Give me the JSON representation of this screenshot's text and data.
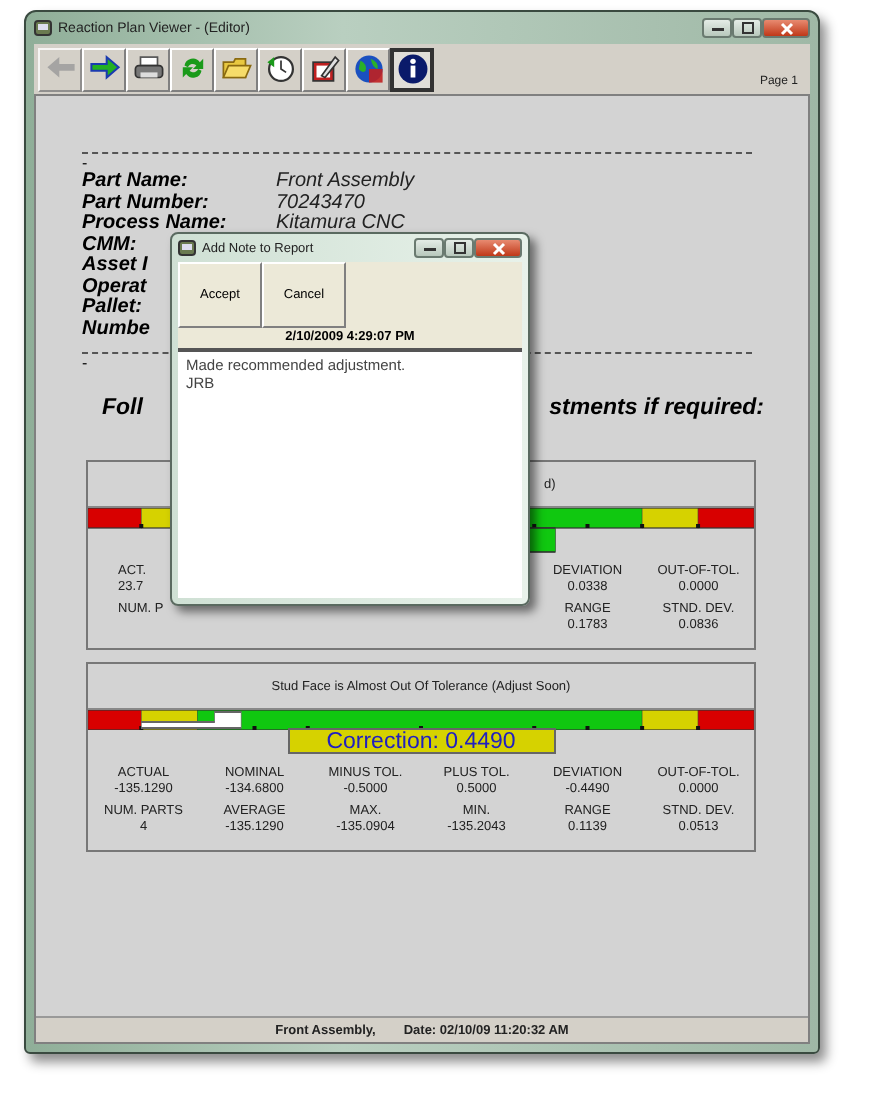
{
  "window": {
    "title": "Reaction Plan Viewer - (Editor)"
  },
  "toolbar": [
    {
      "disabled": true,
      "selected": false
    },
    {
      "disabled": false,
      "selected": false
    },
    {
      "disabled": false,
      "selected": false
    },
    {
      "disabled": false,
      "selected": false
    },
    {
      "disabled": false,
      "selected": false
    },
    {
      "disabled": false,
      "selected": false
    },
    {
      "disabled": false,
      "selected": false
    },
    {
      "disabled": false,
      "selected": false
    },
    {
      "disabled": false,
      "selected": true
    }
  ],
  "page_label": "Page 1",
  "report": {
    "separator_tail_1": "-",
    "fields": [
      {
        "label": "Part Name:",
        "value": "Front Assembly"
      },
      {
        "label": "Part Number:",
        "value": "70243470"
      },
      {
        "label": "Process Name:",
        "value": "Kitamura CNC"
      },
      {
        "label": "CMM:"
      },
      {
        "label": "Asset I"
      },
      {
        "label": "Operat"
      },
      {
        "label": "Pallet:"
      },
      {
        "label": "Numbe"
      }
    ],
    "separator_tail_2": "-",
    "heading_left": "Foll",
    "heading_right": "stments if required:",
    "panels": [
      {
        "title": "d)",
        "stats": [
          [
            {
              "label": "ACT.",
              "value": "23.7"
            }
          ],
          [
            {
              "label": "NUM. P"
            }
          ]
        ],
        "stats_right": [
          [
            {
              "label": "DEVIATION",
              "value": "0.0338"
            },
            {
              "label": "OUT-OF-TOL.",
              "value": "0.0000"
            }
          ],
          [
            {
              "label": "RANGE",
              "value": "0.1783"
            },
            {
              "label": "STND. DEV.",
              "value": "0.0836"
            }
          ]
        ]
      },
      {
        "title": "Stud Face is Almost Out Of Tolerance (Adjust Soon)",
        "correction": "Correction: 0.4490",
        "stats": [
          [
            {
              "label": "ACTUAL",
              "value": "-135.1290"
            },
            {
              "label": "NOMINAL",
              "value": "-134.6800"
            },
            {
              "label": "MINUS TOL.",
              "value": "-0.5000"
            },
            {
              "label": "PLUS TOL.",
              "value": "0.5000"
            },
            {
              "label": "DEVIATION",
              "value": "-0.4490"
            },
            {
              "label": "OUT-OF-TOL.",
              "value": "0.0000"
            }
          ],
          [
            {
              "label": "NUM. PARTS",
              "value": "4"
            },
            {
              "label": "AVERAGE",
              "value": "-135.1290"
            },
            {
              "label": "MAX.",
              "value": "-135.0904"
            },
            {
              "label": "MIN.",
              "value": "-135.2043"
            },
            {
              "label": "RANGE",
              "value": "0.1139"
            },
            {
              "label": "STND. DEV.",
              "value": "0.0513"
            }
          ]
        ]
      }
    ]
  },
  "status_bar": {
    "part": "Front Assembly,",
    "date": "Date: 02/10/09 11:20:32 AM"
  },
  "dialog": {
    "title": "Add Note to Report",
    "buttons": [
      "Accept",
      "Cancel"
    ],
    "timestamp": "2/10/2009 4:29:07 PM",
    "note": "Made recommended adjustment.\nJRB"
  }
}
